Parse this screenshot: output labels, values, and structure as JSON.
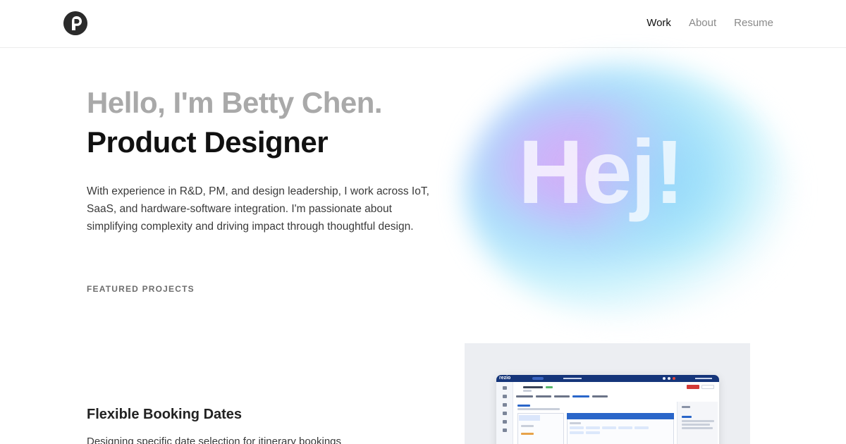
{
  "nav": {
    "items": [
      {
        "label": "Work",
        "active": true
      },
      {
        "label": "About",
        "active": false
      },
      {
        "label": "Resume",
        "active": false
      }
    ]
  },
  "hero": {
    "greeting": "Hello, I'm Betty Chen.",
    "role": "Product Designer",
    "intro": "With experience in R&D, PM, and design leadership, I work across IoT, SaaS, and hardware-software integration. I'm passionate about simplifying complexity and driving impact through thoughtful design.",
    "art_text": "Hej!"
  },
  "featured": {
    "heading": "FEATURED PROJECTS",
    "projects": [
      {
        "title": "Flexible Booking Dates",
        "description": "Designing specific date selection for itinerary bookings",
        "thumbnail_brand": "rezio"
      }
    ]
  },
  "colors": {
    "text_primary": "#111111",
    "text_muted": "#a9a9a9",
    "nav_inactive": "#8a8a8a",
    "card_bg": "#eceef2",
    "mock_header": "#15357a"
  }
}
